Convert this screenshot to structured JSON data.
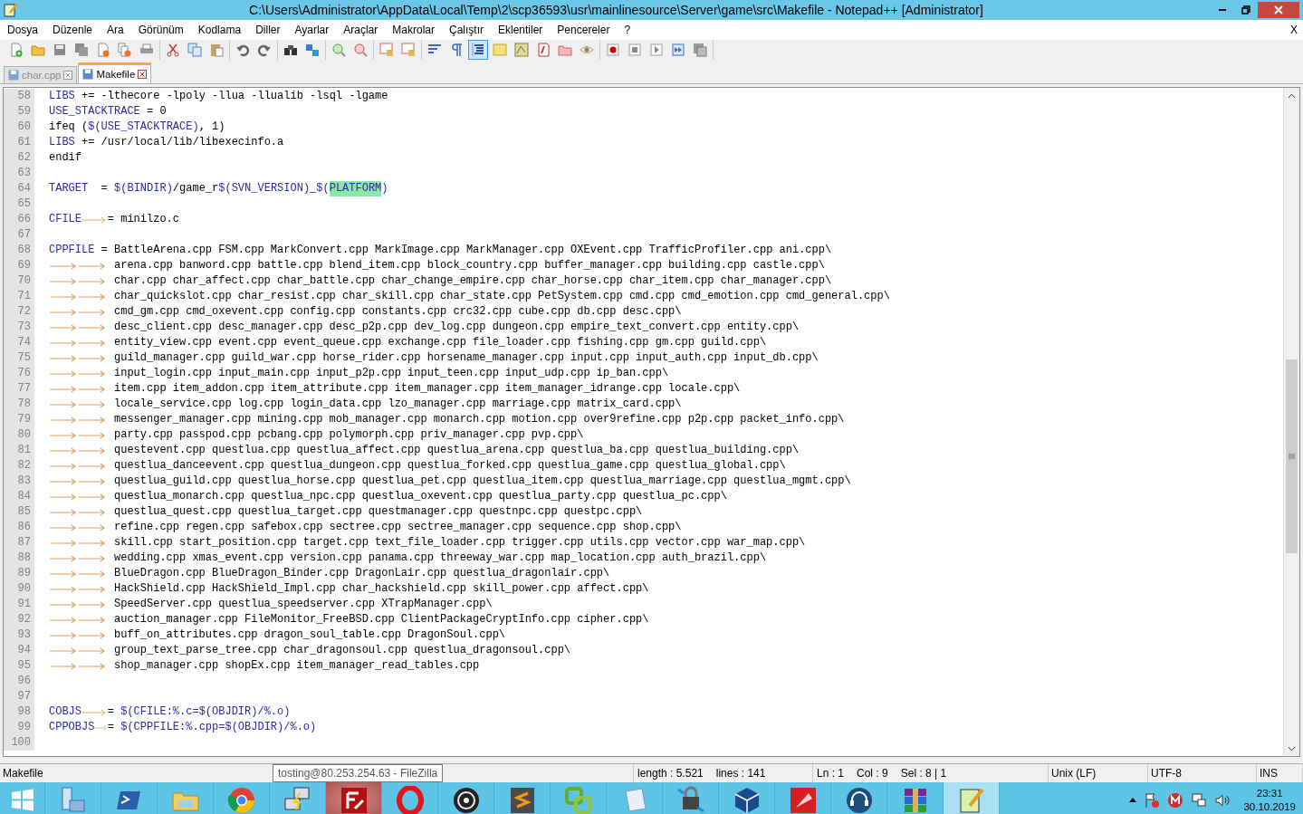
{
  "window": {
    "title": "C:\\Users\\Administrator\\AppData\\Local\\Temp\\2\\scp36593\\usr\\mainlinesource\\Server\\game\\src\\Makefile - Notepad++ [Administrator]"
  },
  "menu": [
    "Dosya",
    "Düzenle",
    "Ara",
    "Görünüm",
    "Kodlama",
    "Diller",
    "Ayarlar",
    "Araçlar",
    "Makrolar",
    "Çalıştır",
    "Eklentiler",
    "Pencereler",
    "?"
  ],
  "menu_close": "X",
  "toolbar": [
    [
      {
        "kind": "new",
        "on": false
      },
      {
        "kind": "open",
        "on": false
      },
      {
        "kind": "save",
        "on": false
      },
      {
        "kind": "save-all",
        "on": false
      },
      {
        "kind": "close",
        "on": false
      },
      {
        "kind": "close-all",
        "on": false
      },
      {
        "kind": "print",
        "on": false
      }
    ],
    [
      {
        "kind": "cut",
        "on": false
      },
      {
        "kind": "copy",
        "on": false
      },
      {
        "kind": "paste",
        "on": false
      }
    ],
    [
      {
        "kind": "undo",
        "on": false
      },
      {
        "kind": "redo",
        "on": false
      }
    ],
    [
      {
        "kind": "find",
        "on": false
      },
      {
        "kind": "replace",
        "on": false
      }
    ],
    [
      {
        "kind": "zoom-in",
        "on": false
      },
      {
        "kind": "zoom-out",
        "on": false
      }
    ],
    [
      {
        "kind": "sync-v",
        "on": false
      },
      {
        "kind": "sync-h",
        "on": false
      }
    ],
    [
      {
        "kind": "wrap",
        "on": false
      },
      {
        "kind": "all-chars",
        "on": false
      },
      {
        "kind": "indent",
        "on": true
      },
      {
        "kind": "udl",
        "on": false
      },
      {
        "kind": "doc-map",
        "on": false
      },
      {
        "kind": "func-list",
        "on": false
      },
      {
        "kind": "folder",
        "on": false
      },
      {
        "kind": "monitor",
        "on": false
      }
    ],
    [
      {
        "kind": "record",
        "on": false
      },
      {
        "kind": "stop",
        "on": false
      },
      {
        "kind": "play",
        "on": false
      },
      {
        "kind": "play-multi",
        "on": false
      },
      {
        "kind": "save-macro",
        "on": false
      }
    ]
  ],
  "tabs": [
    {
      "label": "char.cpp",
      "selected": false
    },
    {
      "label": "Makefile",
      "selected": true
    }
  ],
  "lines": [
    {
      "number": "58",
      "tokens": [
        {
          "kind": "var",
          "text": "LIBS"
        },
        {
          "kind": "plain",
          "text": " += -lthecore -lpoly -llua -llualib -lsql -lgame"
        }
      ]
    },
    {
      "number": "59",
      "tokens": [
        {
          "kind": "var",
          "text": "USE_STACKTRACE"
        },
        {
          "kind": "plain",
          "text": " = 0"
        }
      ]
    },
    {
      "number": "60",
      "tokens": [
        {
          "kind": "plain",
          "text": "ifeq ("
        },
        {
          "kind": "var",
          "text": "$(USE_STACKTRACE)"
        },
        {
          "kind": "plain",
          "text": ", 1)"
        }
      ]
    },
    {
      "number": "61",
      "tokens": [
        {
          "kind": "var",
          "text": "LIBS"
        },
        {
          "kind": "plain",
          "text": " += /usr/local/lib/libexecinfo.a"
        }
      ]
    },
    {
      "number": "62",
      "tokens": [
        {
          "kind": "plain",
          "text": "endif"
        }
      ]
    },
    {
      "number": "63"
    },
    {
      "number": "64",
      "tokens": [
        {
          "kind": "var",
          "text": "TARGET"
        },
        {
          "kind": "plain",
          "text": "  = "
        },
        {
          "kind": "var",
          "text": "$(BINDIR)"
        },
        {
          "kind": "plain",
          "text": "/game_r"
        },
        {
          "kind": "var",
          "text": "$(SVN_VERSION)"
        },
        {
          "kind": "plain",
          "text": "_"
        },
        {
          "kind": "var",
          "text": "$("
        },
        {
          "kind": "match",
          "text": "PLATFORM"
        },
        {
          "kind": "var",
          "text": ")"
        }
      ]
    },
    {
      "number": "65"
    },
    {
      "number": "66",
      "tokens": [
        {
          "kind": "var",
          "text": "CFILE"
        },
        {
          "kind": "tab"
        },
        {
          "kind": "plain",
          "text": "= minilzo.c"
        }
      ]
    },
    {
      "number": "67"
    },
    {
      "number": "68",
      "tokens": [
        {
          "kind": "var",
          "text": "CPPFILE"
        },
        {
          "kind": "plain",
          "text": " = BattleArena.cpp FSM.cpp MarkConvert.cpp MarkImage.cpp MarkManager.cpp OXEvent.cpp TrafficProfiler.cpp ani.cpp\\"
        }
      ]
    },
    {
      "number": "69",
      "tokens": [
        {
          "kind": "tab"
        },
        {
          "kind": "tab"
        },
        {
          "kind": "plain",
          "text": " arena.cpp banword.cpp battle.cpp blend_item.cpp block_country.cpp buffer_manager.cpp building.cpp castle.cpp\\"
        }
      ]
    },
    {
      "number": "70",
      "tokens": [
        {
          "kind": "tab"
        },
        {
          "kind": "tab"
        },
        {
          "kind": "plain",
          "text": " char.cpp char_affect.cpp char_battle.cpp char_change_empire.cpp char_horse.cpp char_item.cpp char_manager.cpp\\"
        }
      ]
    },
    {
      "number": "71",
      "tokens": [
        {
          "kind": "tab"
        },
        {
          "kind": "tab"
        },
        {
          "kind": "plain",
          "text": " char_quickslot.cpp char_resist.cpp char_skill.cpp char_state.cpp PetSystem.cpp cmd.cpp cmd_emotion.cpp cmd_general.cpp\\"
        }
      ]
    },
    {
      "number": "72",
      "tokens": [
        {
          "kind": "tab"
        },
        {
          "kind": "tab"
        },
        {
          "kind": "plain",
          "text": " cmd_gm.cpp cmd_oxevent.cpp config.cpp constants.cpp crc32.cpp cube.cpp db.cpp desc.cpp\\"
        }
      ]
    },
    {
      "number": "73",
      "tokens": [
        {
          "kind": "tab"
        },
        {
          "kind": "tab"
        },
        {
          "kind": "plain",
          "text": " desc_client.cpp desc_manager.cpp desc_p2p.cpp dev_log.cpp dungeon.cpp empire_text_convert.cpp entity.cpp\\"
        }
      ]
    },
    {
      "number": "74",
      "tokens": [
        {
          "kind": "tab"
        },
        {
          "kind": "tab"
        },
        {
          "kind": "plain",
          "text": " entity_view.cpp event.cpp event_queue.cpp exchange.cpp file_loader.cpp fishing.cpp gm.cpp guild.cpp\\"
        }
      ]
    },
    {
      "number": "75",
      "tokens": [
        {
          "kind": "tab"
        },
        {
          "kind": "tab"
        },
        {
          "kind": "plain",
          "text": " guild_manager.cpp guild_war.cpp horse_rider.cpp horsename_manager.cpp input.cpp input_auth.cpp input_db.cpp\\"
        }
      ]
    },
    {
      "number": "76",
      "tokens": [
        {
          "kind": "tab"
        },
        {
          "kind": "tab"
        },
        {
          "kind": "plain",
          "text": " input_login.cpp input_main.cpp input_p2p.cpp input_teen.cpp input_udp.cpp ip_ban.cpp\\"
        }
      ]
    },
    {
      "number": "77",
      "tokens": [
        {
          "kind": "tab"
        },
        {
          "kind": "tab"
        },
        {
          "kind": "plain",
          "text": " item.cpp item_addon.cpp item_attribute.cpp item_manager.cpp item_manager_idrange.cpp locale.cpp\\"
        }
      ]
    },
    {
      "number": "78",
      "tokens": [
        {
          "kind": "tab"
        },
        {
          "kind": "tab"
        },
        {
          "kind": "plain",
          "text": " locale_service.cpp log.cpp login_data.cpp lzo_manager.cpp marriage.cpp matrix_card.cpp\\"
        }
      ]
    },
    {
      "number": "79",
      "tokens": [
        {
          "kind": "tab"
        },
        {
          "kind": "tab"
        },
        {
          "kind": "plain",
          "text": " messenger_manager.cpp mining.cpp mob_manager.cpp monarch.cpp motion.cpp over9refine.cpp p2p.cpp packet_info.cpp\\"
        }
      ]
    },
    {
      "number": "80",
      "tokens": [
        {
          "kind": "tab"
        },
        {
          "kind": "tab"
        },
        {
          "kind": "plain",
          "text": " party.cpp passpod.cpp pcbang.cpp polymorph.cpp priv_manager.cpp pvp.cpp\\"
        }
      ]
    },
    {
      "number": "81",
      "tokens": [
        {
          "kind": "tab"
        },
        {
          "kind": "tab"
        },
        {
          "kind": "plain",
          "text": " questevent.cpp questlua.cpp questlua_affect.cpp questlua_arena.cpp questlua_ba.cpp questlua_building.cpp\\"
        }
      ]
    },
    {
      "number": "82",
      "tokens": [
        {
          "kind": "tab"
        },
        {
          "kind": "tab"
        },
        {
          "kind": "plain",
          "text": " questlua_danceevent.cpp questlua_dungeon.cpp questlua_forked.cpp questlua_game.cpp questlua_global.cpp\\"
        }
      ]
    },
    {
      "number": "83",
      "tokens": [
        {
          "kind": "tab"
        },
        {
          "kind": "tab"
        },
        {
          "kind": "plain",
          "text": " questlua_guild.cpp questlua_horse.cpp questlua_pet.cpp questlua_item.cpp questlua_marriage.cpp questlua_mgmt.cpp\\"
        }
      ]
    },
    {
      "number": "84",
      "tokens": [
        {
          "kind": "tab"
        },
        {
          "kind": "tab"
        },
        {
          "kind": "plain",
          "text": " questlua_monarch.cpp questlua_npc.cpp questlua_oxevent.cpp questlua_party.cpp questlua_pc.cpp\\"
        }
      ]
    },
    {
      "number": "85",
      "tokens": [
        {
          "kind": "tab"
        },
        {
          "kind": "tab"
        },
        {
          "kind": "plain",
          "text": " questlua_quest.cpp questlua_target.cpp questmanager.cpp questnpc.cpp questpc.cpp\\"
        }
      ]
    },
    {
      "number": "86",
      "tokens": [
        {
          "kind": "tab"
        },
        {
          "kind": "tab"
        },
        {
          "kind": "plain",
          "text": " refine.cpp regen.cpp safebox.cpp sectree.cpp sectree_manager.cpp sequence.cpp shop.cpp\\"
        }
      ]
    },
    {
      "number": "87",
      "tokens": [
        {
          "kind": "tab"
        },
        {
          "kind": "tab"
        },
        {
          "kind": "plain",
          "text": " skill.cpp start_position.cpp target.cpp text_file_loader.cpp trigger.cpp utils.cpp vector.cpp war_map.cpp\\"
        }
      ]
    },
    {
      "number": "88",
      "tokens": [
        {
          "kind": "tab"
        },
        {
          "kind": "tab"
        },
        {
          "kind": "plain",
          "text": " wedding.cpp xmas_event.cpp version.cpp panama.cpp threeway_war.cpp map_location.cpp auth_brazil.cpp\\"
        }
      ]
    },
    {
      "number": "89",
      "tokens": [
        {
          "kind": "tab"
        },
        {
          "kind": "tab"
        },
        {
          "kind": "plain",
          "text": " BlueDragon.cpp BlueDragon_Binder.cpp DragonLair.cpp questlua_dragonlair.cpp\\"
        }
      ]
    },
    {
      "number": "90",
      "tokens": [
        {
          "kind": "tab"
        },
        {
          "kind": "tab"
        },
        {
          "kind": "plain",
          "text": " HackShield.cpp HackShield_Impl.cpp char_hackshield.cpp skill_power.cpp affect.cpp\\"
        }
      ]
    },
    {
      "number": "91",
      "tokens": [
        {
          "kind": "tab"
        },
        {
          "kind": "tab"
        },
        {
          "kind": "plain",
          "text": " SpeedServer.cpp questlua_speedserver.cpp XTrapManager.cpp\\"
        }
      ]
    },
    {
      "number": "92",
      "tokens": [
        {
          "kind": "tab"
        },
        {
          "kind": "tab"
        },
        {
          "kind": "plain",
          "text": " auction_manager.cpp FileMonitor_FreeBSD.cpp ClientPackageCryptInfo.cpp cipher.cpp\\"
        }
      ]
    },
    {
      "number": "93",
      "tokens": [
        {
          "kind": "tab"
        },
        {
          "kind": "tab"
        },
        {
          "kind": "plain",
          "text": " buff_on_attributes.cpp dragon_soul_table.cpp DragonSoul.cpp\\"
        }
      ]
    },
    {
      "number": "94",
      "tokens": [
        {
          "kind": "tab"
        },
        {
          "kind": "tab"
        },
        {
          "kind": "plain",
          "text": " group_text_parse_tree.cpp char_dragonsoul.cpp questlua_dragonsoul.cpp\\"
        }
      ]
    },
    {
      "number": "95",
      "tokens": [
        {
          "kind": "tab"
        },
        {
          "kind": "tab"
        },
        {
          "kind": "plain",
          "text": " shop_manager.cpp shopEx.cpp item_manager_read_tables.cpp"
        }
      ]
    },
    {
      "number": "96"
    },
    {
      "number": "97"
    },
    {
      "number": "98",
      "tokens": [
        {
          "kind": "var",
          "text": "COBJS"
        },
        {
          "kind": "tab"
        },
        {
          "kind": "plain",
          "text": "= "
        },
        {
          "kind": "var",
          "text": "$(CFILE:%.c=$(OBJDIR)/%.o)"
        }
      ]
    },
    {
      "number": "99",
      "tokens": [
        {
          "kind": "var",
          "text": "CPPOBJS"
        },
        {
          "kind": "tab"
        },
        {
          "kind": "plain",
          "text": "= "
        },
        {
          "kind": "var",
          "text": "$(CPPFILE:%.cpp=$(OBJDIR)/%.o)"
        }
      ]
    },
    {
      "number": "100"
    }
  ],
  "status_bar": {
    "file_type": "Makefile",
    "length": "length : 5.521",
    "lines": "lines : 141",
    "ln": "Ln : 1",
    "col": "Col : 9",
    "sel": "Sel : 8 | 1",
    "eol": "Unix (LF)",
    "encoding": "UTF-8",
    "mode": "INS"
  },
  "tooltip": "tosting@80.253.254.63 - FileZilla",
  "taskbar": [
    {
      "kind": "start",
      "selected": false,
      "hovered": false
    },
    {
      "kind": "server",
      "selected": false,
      "hovered": false
    },
    {
      "kind": "shell",
      "selected": false,
      "hovered": false
    },
    {
      "kind": "explorer",
      "selected": false,
      "hovered": false
    },
    {
      "kind": "ring",
      "selected": false,
      "hovered": false
    },
    {
      "kind": "network",
      "selected": false,
      "hovered": false
    },
    {
      "kind": "ftp",
      "selected": false,
      "hovered": true
    },
    {
      "kind": "ring-o",
      "selected": false,
      "hovered": false
    },
    {
      "kind": "aperture",
      "selected": false,
      "hovered": false
    },
    {
      "kind": "editor",
      "selected": false,
      "hovered": false
    },
    {
      "kind": "vm",
      "selected": false,
      "hovered": false
    },
    {
      "kind": "notepad",
      "selected": false,
      "hovered": false
    },
    {
      "kind": "lock",
      "selected": false,
      "hovered": false
    },
    {
      "kind": "cube",
      "selected": false,
      "hovered": false
    },
    {
      "kind": "red",
      "selected": false,
      "hovered": false
    },
    {
      "kind": "headset",
      "selected": false,
      "hovered": false
    },
    {
      "kind": "archive",
      "selected": false,
      "hovered": false
    },
    {
      "kind": "npp",
      "selected": true,
      "hovered": false
    }
  ],
  "clock": {
    "time": "23:31",
    "date": "30.10.2019"
  }
}
